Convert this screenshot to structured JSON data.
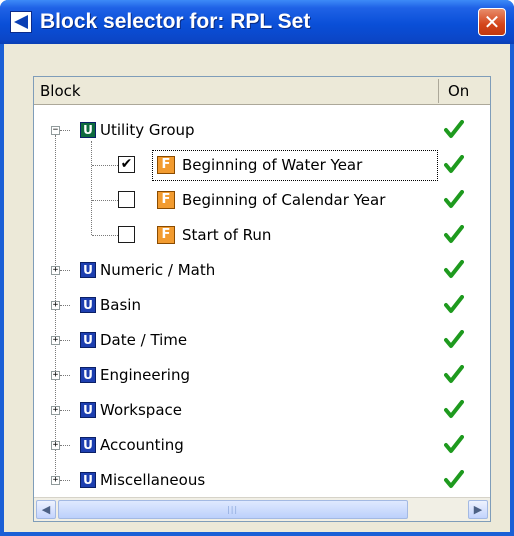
{
  "window": {
    "title": "Block selector for: RPL Set",
    "close_glyph": "✕"
  },
  "columns": {
    "block": "Block",
    "on": "On"
  },
  "tree": {
    "group": {
      "label": "Utility Group",
      "expanded": true,
      "on": true
    },
    "children": [
      {
        "label": "Beginning of Water Year",
        "checked": true,
        "on": true,
        "focused": true
      },
      {
        "label": "Beginning of Calendar Year",
        "checked": false,
        "on": true
      },
      {
        "label": "Start of Run",
        "checked": false,
        "on": true
      }
    ],
    "collapsed_groups": [
      {
        "label": "Numeric / Math",
        "on": true
      },
      {
        "label": "Basin",
        "on": true
      },
      {
        "label": "Date / Time",
        "on": true
      },
      {
        "label": "Engineering",
        "on": true
      },
      {
        "label": "Workspace",
        "on": true
      },
      {
        "label": "Accounting",
        "on": true
      },
      {
        "label": "Miscellaneous",
        "on": true
      }
    ]
  },
  "colors": {
    "title_bar": "#0a4fd8",
    "check_green": "#1e9a1e",
    "close_red": "#d4441a",
    "function_icon": "#f29b2f",
    "util_icon": "#1d3fb0"
  },
  "icons": {
    "group": "u-icon",
    "function": "f-icon",
    "on": "green-check-icon"
  }
}
